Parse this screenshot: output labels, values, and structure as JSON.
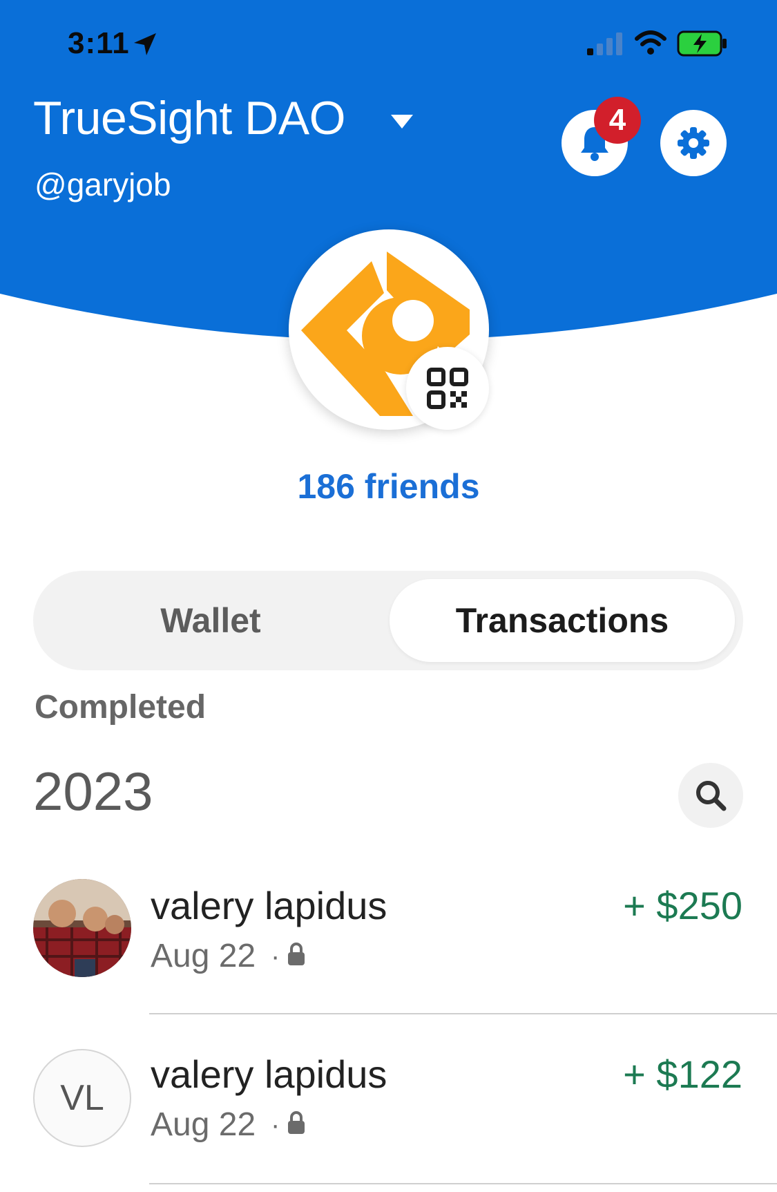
{
  "status_bar": {
    "time": "3:11"
  },
  "header": {
    "account_name": "TrueSight DAO",
    "handle": "@garyjob",
    "notification_count": "4",
    "brand_color": "#0a6fd8",
    "icons": [
      "caret-down-icon",
      "bell-icon",
      "gear-icon"
    ]
  },
  "profile": {
    "friends": "186 friends",
    "logo_color": "#fba61a",
    "icons": [
      "truesight-logo-icon",
      "qr-code-icon"
    ]
  },
  "tabs": {
    "wallet": "Wallet",
    "transactions": "Transactions",
    "active": "Transactions"
  },
  "transactions": {
    "section": "Completed",
    "year": "2023",
    "amount_color": "#1c7a52",
    "items": [
      {
        "name": "valery lapidus",
        "date": "Aug 22",
        "separator": "·",
        "amount": "+ $250",
        "avatar": "photo"
      },
      {
        "name": "valery lapidus",
        "date": "Aug 22",
        "separator": "·",
        "amount": "+ $122",
        "avatar": "initials",
        "initials": "VL"
      }
    ]
  }
}
